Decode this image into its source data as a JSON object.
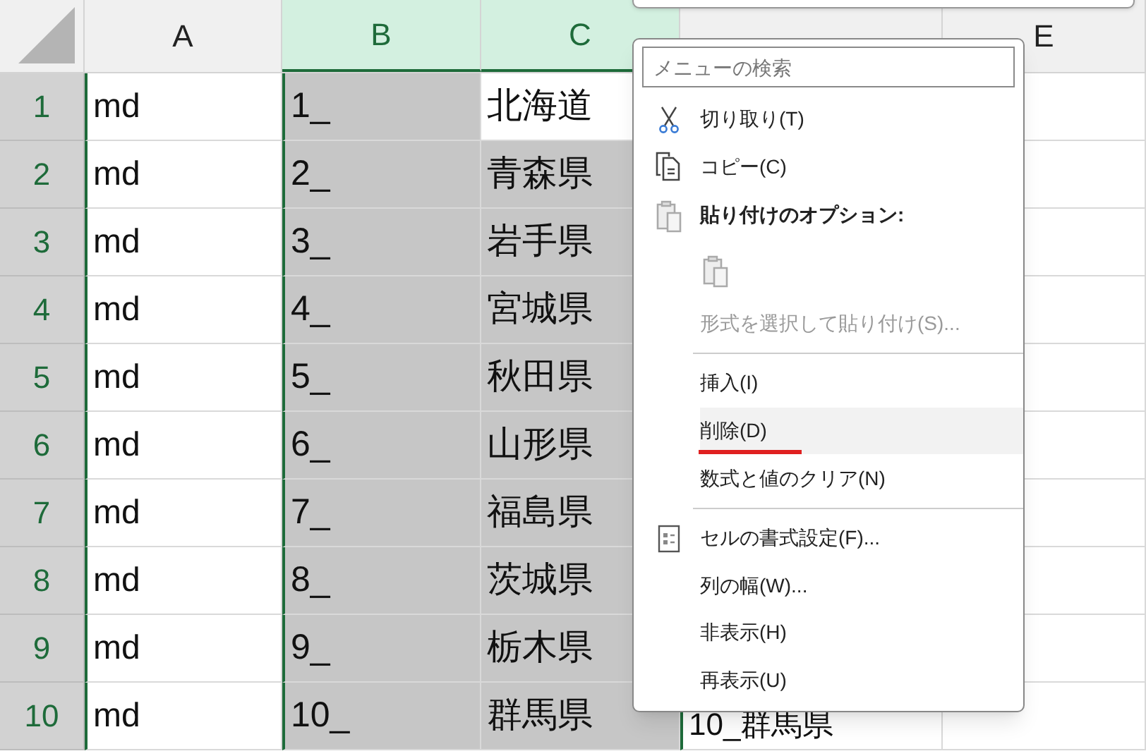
{
  "columns": [
    {
      "label": "A",
      "selected": false
    },
    {
      "label": "B",
      "selected": true
    },
    {
      "label": "C",
      "selected": true
    },
    {
      "selected": false
    },
    {
      "label": "E",
      "selected": false
    }
  ],
  "rows": [
    {
      "number": "1",
      "cells": [
        {
          "text": "md",
          "selected": false
        },
        {
          "text": "1_",
          "selected": true
        },
        {
          "text": "北海道",
          "selected": false
        }
      ]
    },
    {
      "number": "2",
      "cells": [
        {
          "text": "md",
          "selected": false
        },
        {
          "text": "2_",
          "selected": true
        },
        {
          "text": "青森県",
          "selected": true
        }
      ]
    },
    {
      "number": "3",
      "cells": [
        {
          "text": "md",
          "selected": false
        },
        {
          "text": "3_",
          "selected": true
        },
        {
          "text": "岩手県",
          "selected": true
        }
      ]
    },
    {
      "number": "4",
      "cells": [
        {
          "text": "md",
          "selected": false
        },
        {
          "text": "4_",
          "selected": true
        },
        {
          "text": "宮城県",
          "selected": true
        }
      ]
    },
    {
      "number": "5",
      "cells": [
        {
          "text": "md",
          "selected": false
        },
        {
          "text": "5_",
          "selected": true
        },
        {
          "text": "秋田県",
          "selected": true
        }
      ]
    },
    {
      "number": "6",
      "cells": [
        {
          "text": "md",
          "selected": false
        },
        {
          "text": "6_",
          "selected": true
        },
        {
          "text": "山形県",
          "selected": true
        }
      ]
    },
    {
      "number": "7",
      "cells": [
        {
          "text": "md",
          "selected": false
        },
        {
          "text": "7_",
          "selected": true
        },
        {
          "text": "福島県",
          "selected": true
        }
      ]
    },
    {
      "number": "8",
      "cells": [
        {
          "text": "md",
          "selected": false
        },
        {
          "text": "8_",
          "selected": true
        },
        {
          "text": "茨城県",
          "selected": true
        }
      ]
    },
    {
      "number": "9",
      "cells": [
        {
          "text": "md",
          "selected": false
        },
        {
          "text": "9_",
          "selected": true
        },
        {
          "text": "栃木県",
          "selected": true
        }
      ]
    },
    {
      "number": "10",
      "cells": [
        {
          "text": "md",
          "selected": false
        },
        {
          "text": "10_",
          "selected": true
        },
        {
          "text": "群馬県",
          "selected": true
        },
        {
          "text": "10_群馬県",
          "selected": false
        }
      ]
    }
  ],
  "context_menu": {
    "search": {
      "placeholder": "メニューの検索"
    },
    "items": [
      {
        "kind": "command",
        "label": "切り取り(T)",
        "disabled": false,
        "highlighted": false,
        "underlined": false
      },
      {
        "kind": "command",
        "label": "コピー(C)",
        "disabled": false,
        "highlighted": false,
        "underlined": false
      },
      {
        "kind": "heading",
        "label": "貼り付けのオプション:"
      },
      {
        "kind": "paste"
      },
      {
        "kind": "command",
        "label": "形式を選択して貼り付け(S)...",
        "disabled": true,
        "highlighted": false,
        "underlined": false
      },
      {
        "kind": "separator"
      },
      {
        "kind": "command",
        "label": "挿入(I)",
        "disabled": false,
        "highlighted": false,
        "underlined": false
      },
      {
        "kind": "command",
        "label": "削除(D)",
        "disabled": false,
        "highlighted": true,
        "underlined": true
      },
      {
        "kind": "command",
        "label": "数式と値のクリア(N)",
        "disabled": false,
        "highlighted": false,
        "underlined": false
      },
      {
        "kind": "separator"
      },
      {
        "kind": "command",
        "label": "セルの書式設定(F)...",
        "disabled": false,
        "highlighted": false,
        "underlined": false
      },
      {
        "kind": "command",
        "label": "列の幅(W)...",
        "disabled": false,
        "highlighted": false,
        "underlined": false
      },
      {
        "kind": "command",
        "label": "非表示(H)",
        "disabled": false,
        "highlighted": false,
        "underlined": false
      },
      {
        "kind": "command",
        "label": "再表示(U)",
        "disabled": false,
        "highlighted": false,
        "underlined": false
      }
    ]
  }
}
